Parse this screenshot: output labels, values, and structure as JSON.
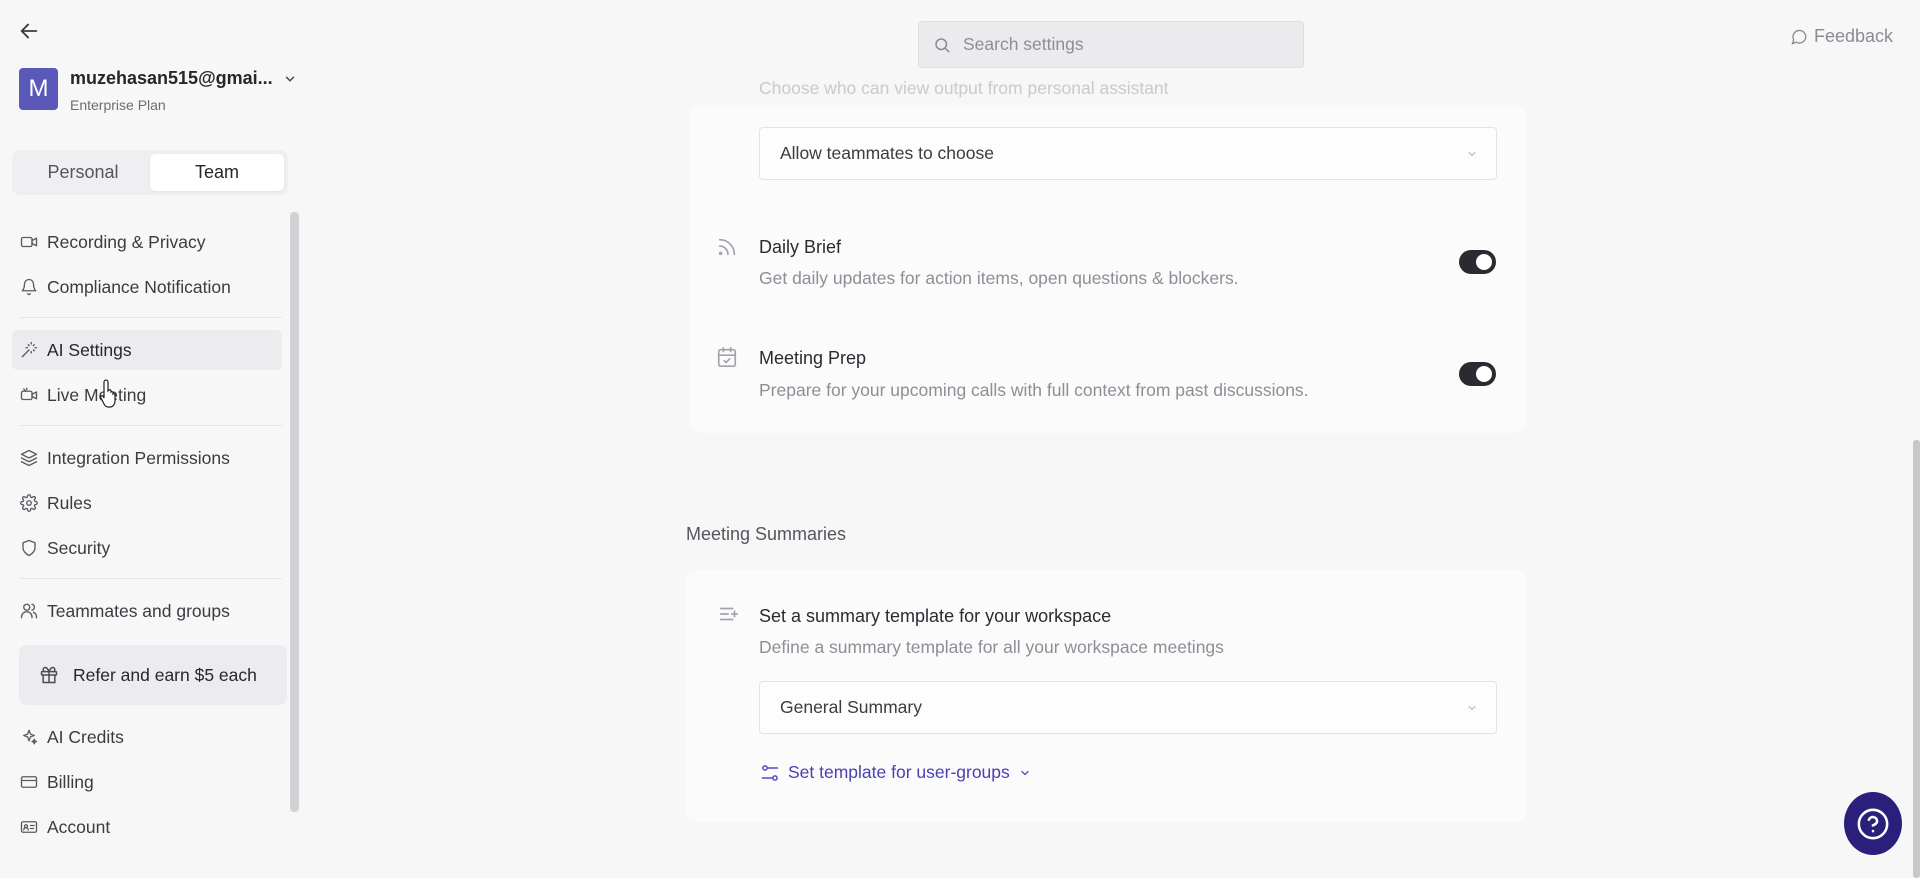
{
  "sidebar": {
    "account": {
      "avatar_letter": "M",
      "email": "muzehasan515@gmai...",
      "plan": "Enterprise Plan"
    },
    "scope_tabs": [
      "Personal",
      "Team"
    ],
    "active_scope": "Team",
    "groups": [
      [
        {
          "label": "Recording & Privacy",
          "icon": "video-camera-icon"
        },
        {
          "label": "Compliance Notification",
          "icon": "bell-icon"
        }
      ],
      [
        {
          "label": "AI Settings",
          "icon": "magic-wand-icon",
          "active": true
        },
        {
          "label": "Live Meeting",
          "icon": "live-video-icon"
        }
      ],
      [
        {
          "label": "Integration Permissions",
          "icon": "layers-icon"
        },
        {
          "label": "Rules",
          "icon": "gear-icon"
        },
        {
          "label": "Security",
          "icon": "shield-icon"
        }
      ],
      [
        {
          "label": "Teammates and groups",
          "icon": "users-icon"
        }
      ]
    ],
    "refer_label": "Refer and earn $5 each",
    "bottom_items": [
      {
        "label": "AI Credits",
        "icon": "sparkle-icon"
      },
      {
        "label": "Billing",
        "icon": "credit-card-icon"
      },
      {
        "label": "Account",
        "icon": "id-card-icon"
      }
    ]
  },
  "header": {
    "search_placeholder": "Search settings",
    "feedback_label": "Feedback"
  },
  "main": {
    "assistant_output_label": "Choose who can view output from personal assistant",
    "assistant_output_value": "Allow teammates to choose",
    "daily_brief": {
      "title": "Daily Brief",
      "description": "Get daily updates for action items, open questions & blockers.",
      "enabled": true
    },
    "meeting_prep": {
      "title": "Meeting Prep",
      "description": "Prepare for your upcoming calls with full context from past discussions.",
      "enabled": true
    },
    "summaries_heading": "Meeting Summaries",
    "summary_template": {
      "title": "Set a summary template for your workspace",
      "description": "Define a summary template for all your workspace meetings",
      "value": "General Summary",
      "user_groups_link": "Set template for user-groups"
    }
  },
  "colors": {
    "accent": "#4b40b3",
    "help_button": "#2a207b",
    "avatar": "#5a58b9"
  }
}
